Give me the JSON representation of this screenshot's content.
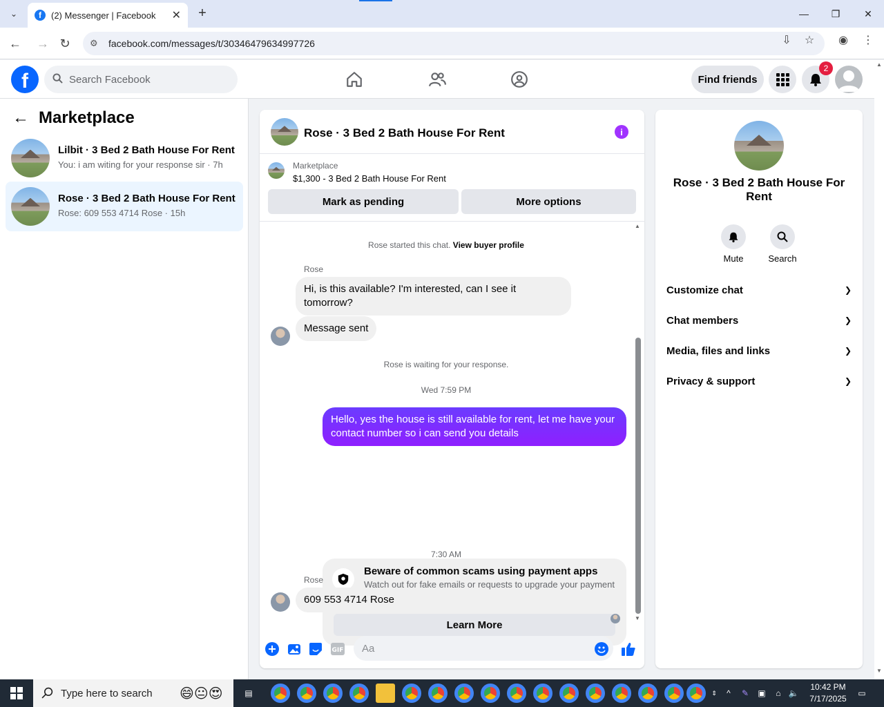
{
  "browser": {
    "tab_title": "(2) Messenger | Facebook",
    "url": "facebook.com/messages/t/30346479634997726",
    "new_tab": "+",
    "tab_close": "✕"
  },
  "fb": {
    "search_placeholder": "Search Facebook",
    "find_friends": "Find friends",
    "notification_count": "2"
  },
  "left": {
    "title": "Marketplace",
    "conversations": [
      {
        "name": "Lilbit · 3 Bed 2 Bath House For Rent",
        "snippet": "You: i am witing for your response sir · 7h"
      },
      {
        "name": "Rose · 3 Bed 2 Bath House For Rent",
        "snippet": "Rose: 609 553 4714 Rose · 15h"
      }
    ]
  },
  "chat": {
    "title": "Rose · 3 Bed 2 Bath House For Rent",
    "marketplace_label": "Marketplace",
    "listing": "$1,300 - 3 Bed 2 Bath House For Rent",
    "mark_pending": "Mark as pending",
    "more_options": "More options",
    "started": "Rose started this chat.",
    "view_profile": "View buyer profile",
    "sender1": "Rose",
    "msg1": "Hi, is this available? I'm interested, can I see it tomorrow?",
    "msg2": "Message sent",
    "waiting": "Rose is waiting for your response.",
    "time1": "Wed 7:59 PM",
    "msg_out": "Hello, yes the house is still available for rent, let me have your contact number so i can send you  details",
    "scam_title": "Beware of common scams using payment apps",
    "scam_body": "Watch out for fake emails or requests to upgrade your payment account.",
    "learn_more": "Learn More",
    "time2": "7:30 AM",
    "sender2": "Rose",
    "msg3": "609 553 4714 Rose",
    "composer_placeholder": "Aa"
  },
  "right": {
    "name": "Rose · 3 Bed 2 Bath House For Rent",
    "mute": "Mute",
    "search": "Search",
    "sections": [
      "Customize chat",
      "Chat members",
      "Media, files and links",
      "Privacy & support"
    ]
  },
  "taskbar": {
    "search_placeholder": "Type here to search",
    "time": "10:42 PM",
    "date": "7/17/2025"
  },
  "colors": {
    "fb_blue": "#0866ff",
    "outgoing_bubble": "#7a28ff",
    "info_purple": "#a033ff",
    "badge_red": "#e41e3f"
  }
}
